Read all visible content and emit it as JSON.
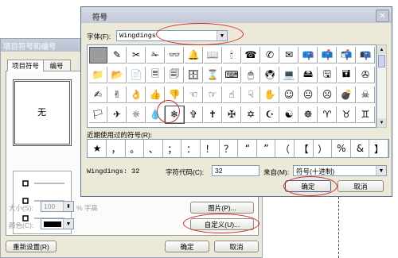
{
  "bullets_dialog": {
    "title": "项目符号和编号",
    "tabs": [
      "项目符号",
      "编号"
    ],
    "none_label": "无",
    "size_label": "大小(S):",
    "size_value": "100",
    "size_unit": "% 字高",
    "color_label": "颜色(C):",
    "picture_button": "图片(P)...",
    "customize_button": "自定义(U)...",
    "reset_button": "重新设置(R)",
    "ok_button": "确定",
    "cancel_button": "取消"
  },
  "symbol_dialog": {
    "title": "符号",
    "close_glyph": "✕",
    "font_label": "字体(F):",
    "font_value": "Wingdings",
    "grid_glyphs": [
      "",
      "✎",
      "✂",
      "✁",
      "👓",
      "🔔",
      "📖",
      "🕯",
      "☎",
      "✆",
      "✉",
      "📪",
      "📫",
      "📬",
      "📭",
      "📁",
      "📂",
      "📄",
      "🗏",
      "🗐",
      "🗄",
      "⌛",
      "⌨",
      "🖱",
      "🖲",
      "💻",
      "🖴",
      "🖫",
      "🖬",
      "✇",
      "✍",
      "✌",
      "👌",
      "👍",
      "👎",
      "☜",
      "☞",
      "☝",
      "☟",
      "✋",
      "☺",
      "😐",
      "☹",
      "💣",
      "☠",
      "🏳",
      "✈",
      "☼",
      "💧",
      "❄",
      "✞",
      "✝",
      "✠",
      "✡",
      "☪",
      "☯",
      "☸",
      "♈",
      "♉",
      "♊"
    ],
    "recent_label": "近期使用过的符号(R):",
    "recent_symbols": [
      "★",
      "，",
      "。",
      "、",
      "；",
      "：",
      "！",
      "？",
      "“",
      "”",
      "（",
      "【",
      "）",
      "%",
      "&",
      "】"
    ],
    "name_text": "Wingdings: 32",
    "char_code_label": "字符代码(C):",
    "char_code_value": "32",
    "from_label": "来自(M):",
    "from_value": "符号(十进制)",
    "ok_button": "确定",
    "cancel_button": "取消"
  },
  "colors": {
    "dialog_bg": "#ece9d8",
    "highlight_ring": "#d12a2a"
  }
}
